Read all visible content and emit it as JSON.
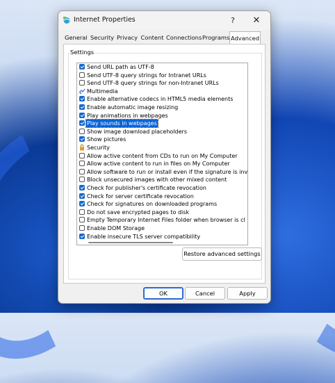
{
  "window": {
    "title": "Internet Properties",
    "help": "?",
    "close": "✕"
  },
  "tabs": [
    {
      "label": "General"
    },
    {
      "label": "Security"
    },
    {
      "label": "Privacy"
    },
    {
      "label": "Content"
    },
    {
      "label": "Connections"
    },
    {
      "label": "Programs"
    },
    {
      "label": "Advanced",
      "active": true
    }
  ],
  "settings_group": "Settings",
  "settings": [
    {
      "type": "check",
      "label": "Send URL path as UTF-8",
      "checked": true
    },
    {
      "type": "check",
      "label": "Send UTF-8 query strings for Intranet URLs",
      "checked": false
    },
    {
      "type": "check",
      "label": "Send UTF-8 query strings for non-Intranet URLs",
      "checked": false
    },
    {
      "type": "category",
      "label": "Multimedia",
      "icon": "multimedia-icon"
    },
    {
      "type": "check",
      "label": "Enable alternative codecs in HTML5 media elements",
      "checked": true
    },
    {
      "type": "check",
      "label": "Enable automatic image resizing",
      "checked": true
    },
    {
      "type": "check",
      "label": "Play animations in webpages",
      "checked": true
    },
    {
      "type": "check",
      "label": "Play sounds in webpages",
      "checked": true,
      "selected": true
    },
    {
      "type": "check",
      "label": "Show image download placeholders",
      "checked": false
    },
    {
      "type": "check",
      "label": "Show pictures",
      "checked": true
    },
    {
      "type": "category",
      "label": "Security",
      "icon": "lock-icon"
    },
    {
      "type": "check",
      "label": "Allow active content from CDs to run on My Computer",
      "checked": false
    },
    {
      "type": "check",
      "label": "Allow active content to run in files on My Computer",
      "checked": false
    },
    {
      "type": "check",
      "label": "Allow software to run or install even if the signature is inv",
      "checked": false
    },
    {
      "type": "check",
      "label": "Block unsecured images with other mixed content",
      "checked": false
    },
    {
      "type": "check",
      "label": "Check for publisher's certificate revocation",
      "checked": true
    },
    {
      "type": "check",
      "label": "Check for server certificate revocation",
      "checked": true
    },
    {
      "type": "check",
      "label": "Check for signatures on downloaded programs",
      "checked": true
    },
    {
      "type": "check",
      "label": "Do not save encrypted pages to disk",
      "checked": false
    },
    {
      "type": "check",
      "label": "Empty Temporary Internet Files folder when browser is cl",
      "checked": false
    },
    {
      "type": "check",
      "label": "Enable DOM Storage",
      "checked": false
    },
    {
      "type": "check",
      "label": "Enable insecure TLS server compatibility",
      "checked": true
    }
  ],
  "restore_button": "Restore advanced settings",
  "footer": {
    "ok": "OK",
    "cancel": "Cancel",
    "apply": "Apply"
  },
  "colors": {
    "accent": "#0a64d8",
    "checkbox": "#1868c8"
  }
}
